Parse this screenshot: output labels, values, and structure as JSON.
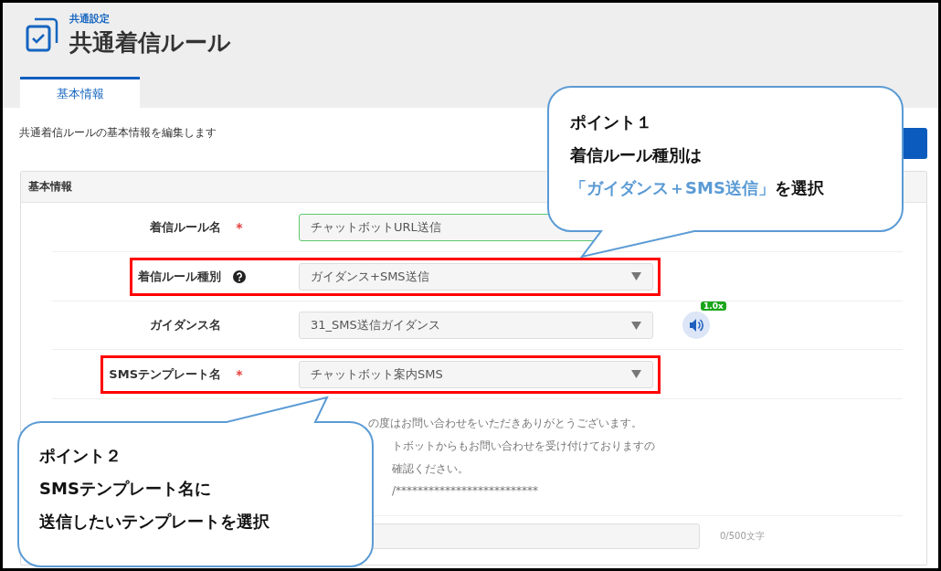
{
  "header": {
    "breadcrumb": "共通設定",
    "title": "共通着信ルール"
  },
  "tabs": [
    {
      "label": "基本情報",
      "selected": true
    }
  ],
  "description": "共通着信ルールの基本情報を編集します",
  "panel": {
    "title": "基本情報",
    "rows": [
      {
        "kind": "text",
        "label": "着信ルール名",
        "required_mark": "*",
        "help": false,
        "value": "チャットボットURL送信",
        "highlighted": false
      },
      {
        "kind": "select",
        "label": "着信ルール種別",
        "help": true,
        "value": "ガイダンス+SMS送信",
        "highlighted": true
      },
      {
        "kind": "select",
        "label": "ガイダンス名",
        "help": false,
        "value": "31_SMS送信ガイダンス",
        "highlighted": false,
        "speed": "1.0x"
      },
      {
        "kind": "select",
        "label": "SMSテンプレート名",
        "required_mark": "*",
        "help": false,
        "value": "チャットボット案内SMS",
        "highlighted": true
      },
      {
        "kind": "preview",
        "lines": [
          "の度はお問い合わせをいただきありがとうございます。",
          "トボットからもお問い合わせを受け付けておりますの",
          "確認ください。",
          "/**************************"
        ]
      },
      {
        "kind": "textarea",
        "counter": "0/500文字"
      }
    ]
  },
  "callouts": [
    {
      "lines": [
        [
          {
            "text": "ポイント１",
            "highlight": false
          }
        ],
        [
          {
            "text": "着信ルール種別は",
            "highlight": false
          }
        ],
        [
          {
            "text": "「ガイダンス＋SMS送信」",
            "highlight": true
          },
          {
            "text": "を選択",
            "highlight": false
          }
        ]
      ]
    },
    {
      "lines": [
        [
          {
            "text": "ポイント２",
            "highlight": false
          }
        ],
        [
          {
            "text": "SMSテンプレート名に",
            "highlight": false
          }
        ],
        [
          {
            "text": "送信したいテンプレートを選択",
            "highlight": false
          }
        ]
      ]
    }
  ]
}
